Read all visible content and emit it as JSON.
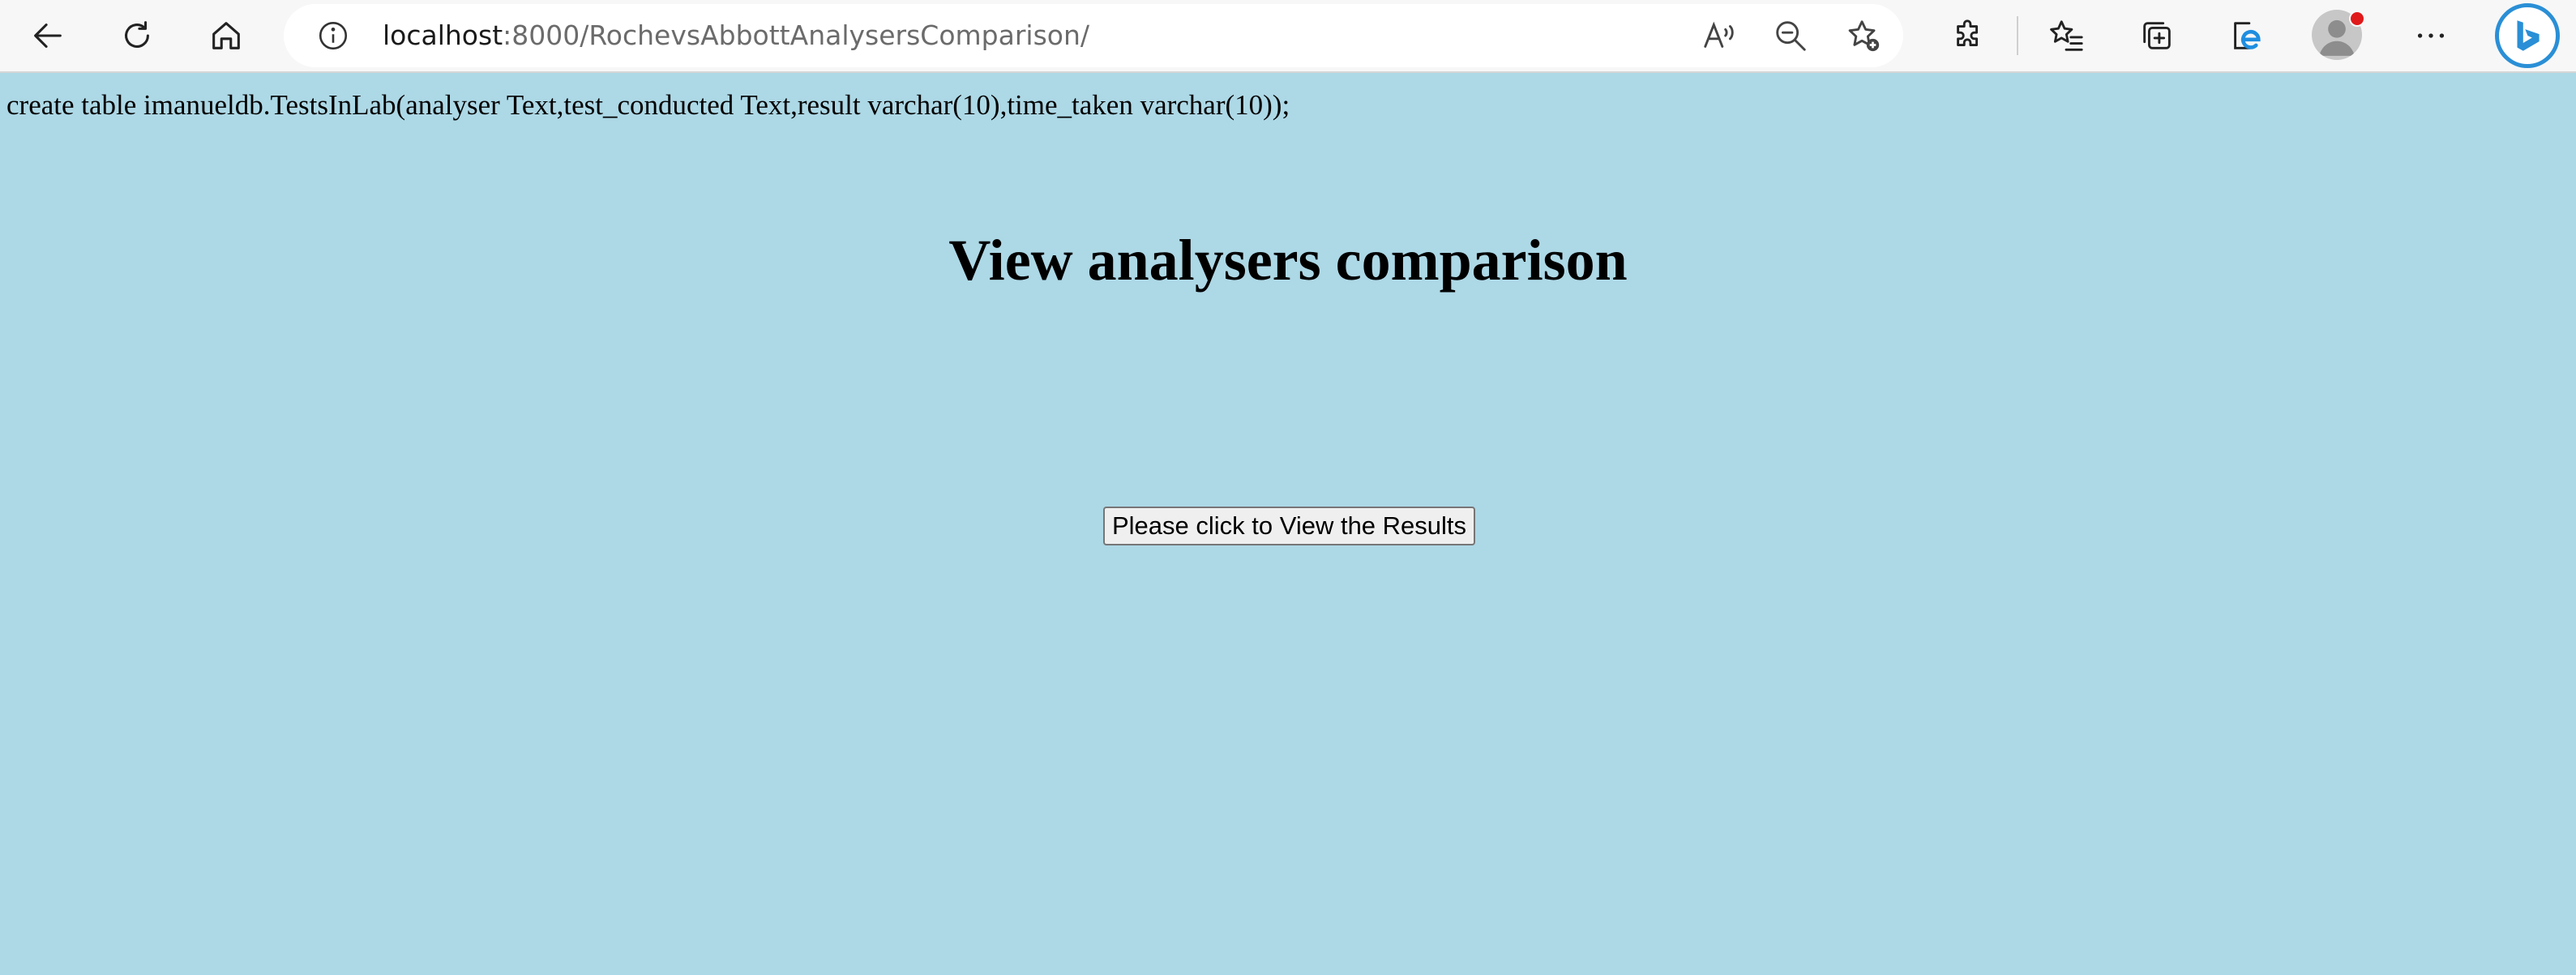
{
  "browser": {
    "url_host": "localhost",
    "url_path": ":8000/RochevsAbbottAnalysersComparison/",
    "icons": {
      "back": "back-arrow-icon",
      "refresh": "refresh-icon",
      "home": "home-icon",
      "info": "info-icon",
      "read_aloud": "read-aloud-icon",
      "zoom_out": "zoom-out-icon",
      "add_favorite": "add-favorite-icon",
      "extensions": "extensions-icon",
      "favorites": "favorites-icon",
      "collections": "collections-icon",
      "ie_mode": "ie-mode-icon",
      "profile": "profile-avatar-icon",
      "more": "more-options-icon",
      "copilot": "bing-copilot-icon"
    },
    "colors": {
      "notification_dot": "#e0191b",
      "copilot_blue": "#2a8fd6"
    }
  },
  "page": {
    "background": "#add8e6",
    "sql_text": "create table imanueldb.TestsInLab(analyser Text,test_conducted Text,result varchar(10),time_taken varchar(10));",
    "heading": "View analysers comparison",
    "button_label": "Please click to View the Results"
  }
}
